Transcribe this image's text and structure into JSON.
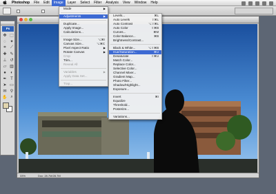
{
  "menubar": {
    "apple": "",
    "items": [
      "Photoshop",
      "File",
      "Edit",
      "Image",
      "Layer",
      "Select",
      "Filter",
      "Analysis",
      "View",
      "Window",
      "Help"
    ],
    "active_index": 3
  },
  "toolbox": {
    "badge": "Ps"
  },
  "image_menu": {
    "items": [
      {
        "label": "Mode",
        "arrow": true
      },
      {
        "sep": true
      },
      {
        "label": "Adjustments",
        "arrow": true,
        "highlight": true
      },
      {
        "sep": true
      },
      {
        "label": "Duplicate..."
      },
      {
        "label": "Apply Image..."
      },
      {
        "label": "Calculations..."
      },
      {
        "sep": true
      },
      {
        "label": "Image Size...",
        "shortcut": "⌥⌘I"
      },
      {
        "label": "Canvas Size...",
        "shortcut": "⌥⌘C"
      },
      {
        "label": "Pixel Aspect Ratio",
        "arrow": true
      },
      {
        "label": "Rotate Canvas",
        "arrow": true
      },
      {
        "label": "Crop",
        "disabled": true
      },
      {
        "label": "Trim..."
      },
      {
        "label": "Reveal All",
        "disabled": true
      },
      {
        "sep": true
      },
      {
        "label": "Variables",
        "arrow": true,
        "disabled": true
      },
      {
        "label": "Apply Data Set...",
        "disabled": true
      },
      {
        "sep": true
      },
      {
        "label": "Trap...",
        "disabled": true
      }
    ]
  },
  "adjust_menu": {
    "items": [
      {
        "label": "Levels...",
        "shortcut": "⌘L"
      },
      {
        "label": "Auto Levels",
        "shortcut": "⇧⌘L"
      },
      {
        "label": "Auto Contrast",
        "shortcut": "⌥⇧⌘L"
      },
      {
        "label": "Auto Color",
        "shortcut": "⇧⌘B"
      },
      {
        "label": "Curves...",
        "shortcut": "⌘M"
      },
      {
        "label": "Color Balance...",
        "shortcut": "⌘B"
      },
      {
        "label": "Brightness/Contrast..."
      },
      {
        "sep": true
      },
      {
        "label": "Black & White...",
        "shortcut": "⌥⇧⌘B"
      },
      {
        "label": "Hue/Saturation...",
        "shortcut": "⌘U",
        "highlight": true
      },
      {
        "label": "Desaturate",
        "shortcut": "⇧⌘U"
      },
      {
        "label": "Match Color..."
      },
      {
        "label": "Replace Color..."
      },
      {
        "label": "Selective Color..."
      },
      {
        "label": "Channel Mixer..."
      },
      {
        "label": "Gradient Map..."
      },
      {
        "label": "Photo Filter..."
      },
      {
        "label": "Shadow/Highlight..."
      },
      {
        "label": "Exposure..."
      },
      {
        "sep": true
      },
      {
        "label": "Invert",
        "shortcut": "⌘I"
      },
      {
        "label": "Equalize"
      },
      {
        "label": "Threshold..."
      },
      {
        "label": "Posterize..."
      },
      {
        "sep": true
      },
      {
        "label": "Variations..."
      }
    ]
  },
  "status": {
    "zoom": "33%",
    "info": "Doc: 28.7M/28.7M"
  },
  "colors": {
    "menu_highlight": "#3d6ad3",
    "sky_top": "#1f5aa8",
    "sky_bottom": "#7fb4e8",
    "foreground_swatch": "#e1d5ae"
  }
}
